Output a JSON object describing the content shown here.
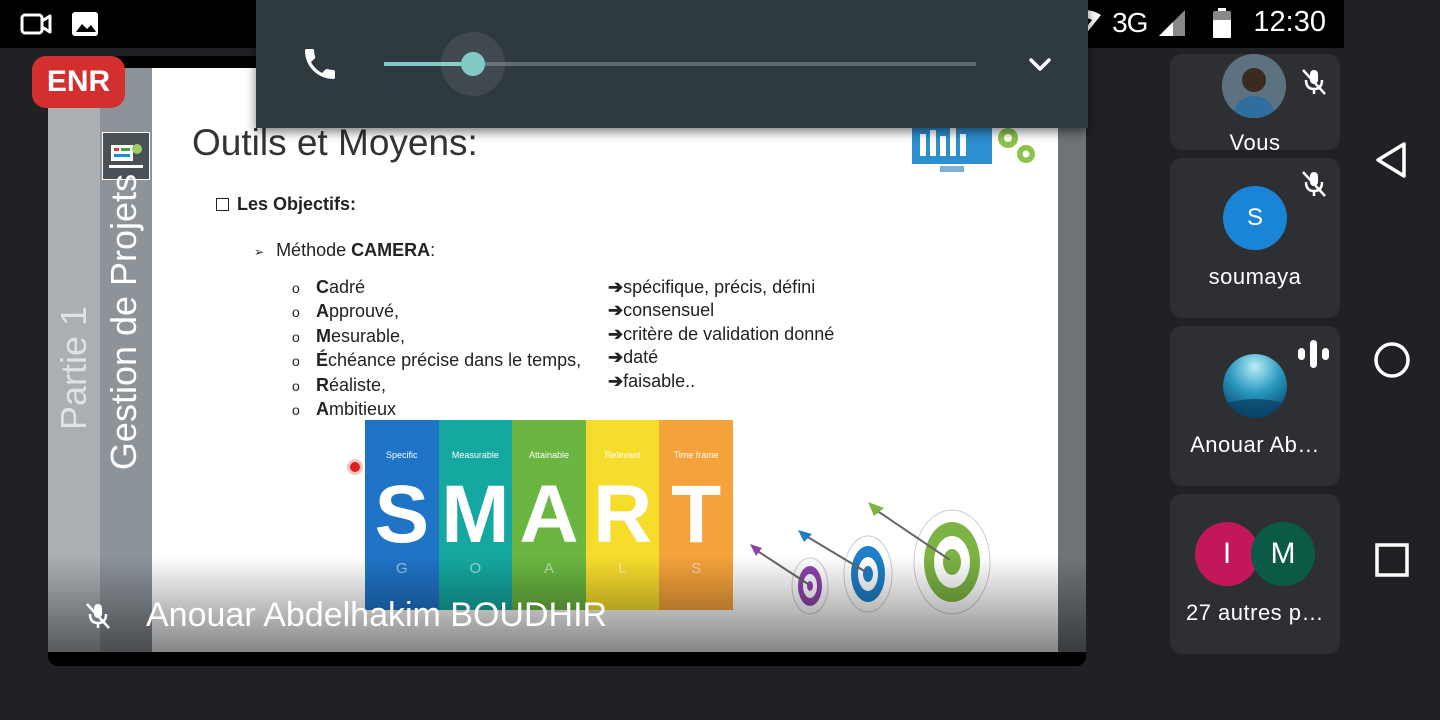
{
  "status_bar": {
    "time": "12:30",
    "network": "3G",
    "icons": [
      "video-camera-icon",
      "image-icon",
      "wifi-icon",
      "signal-icon",
      "battery-icon"
    ]
  },
  "recording_badge": "ENR",
  "volume_panel": {
    "level": 0.15,
    "icons": [
      "phone-icon",
      "chevron-down-icon"
    ],
    "accent_color": "#80cbc4"
  },
  "slide": {
    "sidebar_text_part": "Partie 1",
    "sidebar_text_course": "Gestion de Projets",
    "title": "Outils et Moyens:",
    "objectives_heading": "Les Objectifs:",
    "method_prefix": "Méthode ",
    "method_name": "CAMERA",
    "method_suffix": ":",
    "criteria": [
      {
        "first": "C",
        "rest": "adré",
        "meaning": "spécifique, précis, défini"
      },
      {
        "first": "A",
        "rest": "pprouvé,",
        "meaning": "consensuel"
      },
      {
        "first": "M",
        "rest": "esurable,",
        "meaning": "critère de validation donné"
      },
      {
        "first": "É",
        "rest": "chéance précise dans le temps,",
        "meaning": "daté"
      },
      {
        "first": "R",
        "rest": "éaliste,",
        "meaning": "faisable.."
      },
      {
        "first": "A",
        "rest": "mbitieux",
        "meaning": ""
      }
    ],
    "arrow": "➔",
    "smart": [
      {
        "letter": "S",
        "label": "Specific",
        "goal": "G",
        "color": "#1f74c7"
      },
      {
        "letter": "M",
        "label": "Measurable",
        "goal": "O",
        "color": "#14a8a0"
      },
      {
        "letter": "A",
        "label": "Attainable",
        "goal": "A",
        "color": "#6ab640"
      },
      {
        "letter": "R",
        "label": "Relevant",
        "goal": "L",
        "color": "#f6dd2c"
      },
      {
        "letter": "T",
        "label": "Time frame",
        "goal": "S",
        "color": "#f5a23a"
      }
    ]
  },
  "presenter_name": "Anouar Abdelhakim BOUDHIR",
  "participants": [
    {
      "name": "Vous",
      "muted": true
    },
    {
      "name": "soumaya",
      "initial": "S",
      "muted": true,
      "color": "#1a85d6"
    },
    {
      "name": "Anouar Ab…",
      "speaking": true
    },
    {
      "name": "27 autres p…",
      "initials": [
        "I",
        "M"
      ],
      "colors": [
        "#c2185b",
        "#0b5a45"
      ]
    }
  ],
  "nav": [
    "back-icon",
    "home-icon",
    "recents-icon"
  ]
}
